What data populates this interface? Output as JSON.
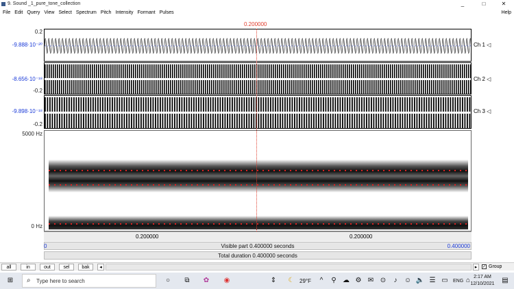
{
  "window": {
    "title": "9. Sound _1_pure_tone_collection",
    "minimize": "_",
    "maximize": "□",
    "close": "✕"
  },
  "menu": {
    "items": [
      "File",
      "Edit",
      "Query",
      "View",
      "Select",
      "Spectrum",
      "Pitch",
      "Intensity",
      "Formant",
      "Pulses"
    ],
    "help": "Help"
  },
  "cursor_time": "0.200000",
  "channels": [
    {
      "top": "0.2",
      "mid": "-9.888·10⁻²⁰",
      "bottom": "",
      "label": "Ch 1"
    },
    {
      "top": "",
      "mid": "-8.656·10⁻¹⁸",
      "bottom": "-0.2",
      "label": "Ch 2"
    },
    {
      "top": "",
      "mid": "-9.898·10⁻¹⁸",
      "bottom": "-0.2",
      "label": "Ch 3"
    }
  ],
  "spectrogram": {
    "max_label": "5000 Hz",
    "min_label": "0 Hz"
  },
  "time_ticks": {
    "left": "0.200000",
    "right": "0.200000"
  },
  "visible": {
    "start": "0",
    "text": "Visible part 0.400000 seconds",
    "end": "0.400000"
  },
  "total": "Total duration 0.400000 seconds",
  "zoom_buttons": [
    "all",
    "in",
    "out",
    "sel",
    "bak"
  ],
  "group_label": "Group",
  "group_checked": true,
  "taskbar": {
    "search_placeholder": "Type here to search",
    "weather": "29°F",
    "lang": "ENG",
    "time": "2:17 AM",
    "date": "12/10/2021"
  }
}
